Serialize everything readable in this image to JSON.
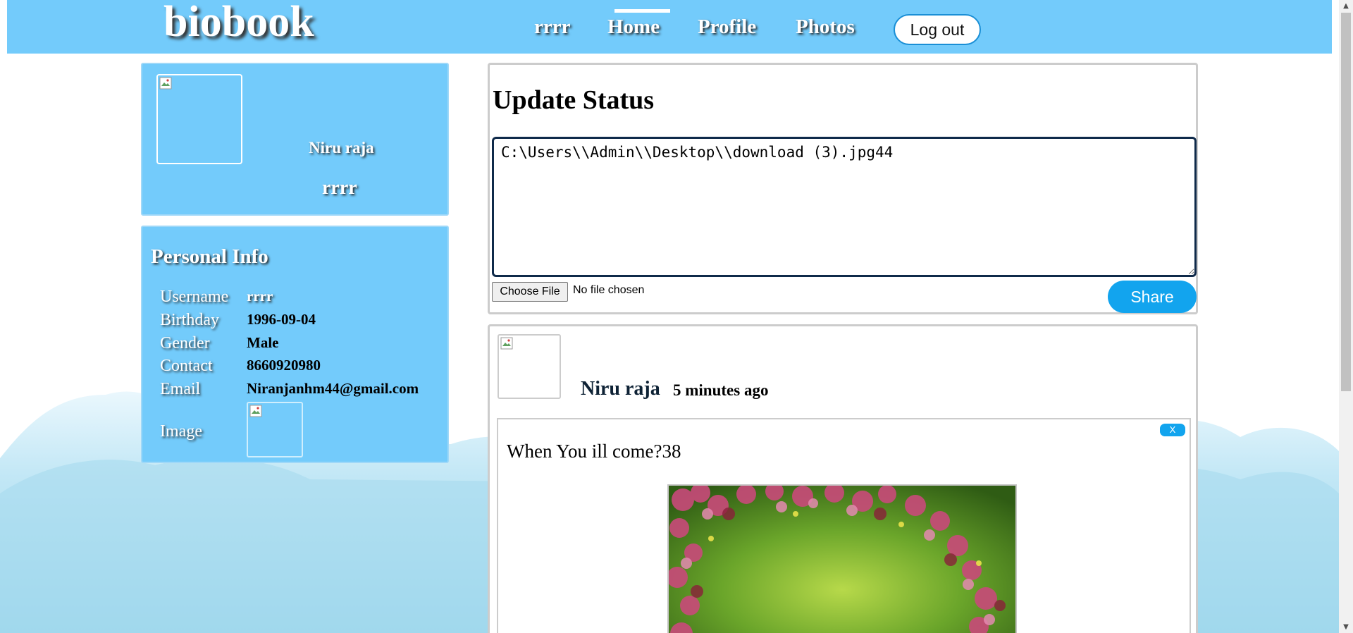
{
  "header": {
    "logo": "biobook",
    "nav": [
      {
        "label": "rrrr",
        "active": false
      },
      {
        "label": "Home",
        "active": true
      },
      {
        "label": "Profile",
        "active": false
      },
      {
        "label": "Photos",
        "active": false
      }
    ],
    "logout_label": "Log out"
  },
  "profile": {
    "name": "Niru raja",
    "username": "rrrr"
  },
  "personal_info": {
    "title": "Personal Info",
    "rows": [
      {
        "label": "Username",
        "value": "rrrr"
      },
      {
        "label": "Birthday",
        "value": "1996-09-04"
      },
      {
        "label": "Gender",
        "value": "Male"
      },
      {
        "label": "Contact",
        "value": "8660920980"
      },
      {
        "label": "Email",
        "value": "Niranjanhm44@gmail.com"
      },
      {
        "label": "Image",
        "value": ""
      }
    ]
  },
  "status": {
    "title": "Update Status",
    "text_value": "C:\\Users\\\\Admin\\\\Desktop\\\\download (3).jpg44",
    "file_button_label": "Choose File",
    "file_status": "No file chosen",
    "share_label": "Share"
  },
  "post": {
    "author": "Niru raja",
    "time": "5 minutes ago",
    "close_label": "X",
    "text": "When You ill come?38"
  },
  "colors": {
    "header_bg": "#73cbfb",
    "panel_bg": "#73cbfb",
    "accent_button": "#12a4ee",
    "textarea_border": "#0f2a4a"
  },
  "icons": {
    "broken_image": "broken-image-icon",
    "scroll_up": "scroll-up-arrow-icon",
    "scroll_down": "scroll-down-arrow-icon"
  }
}
